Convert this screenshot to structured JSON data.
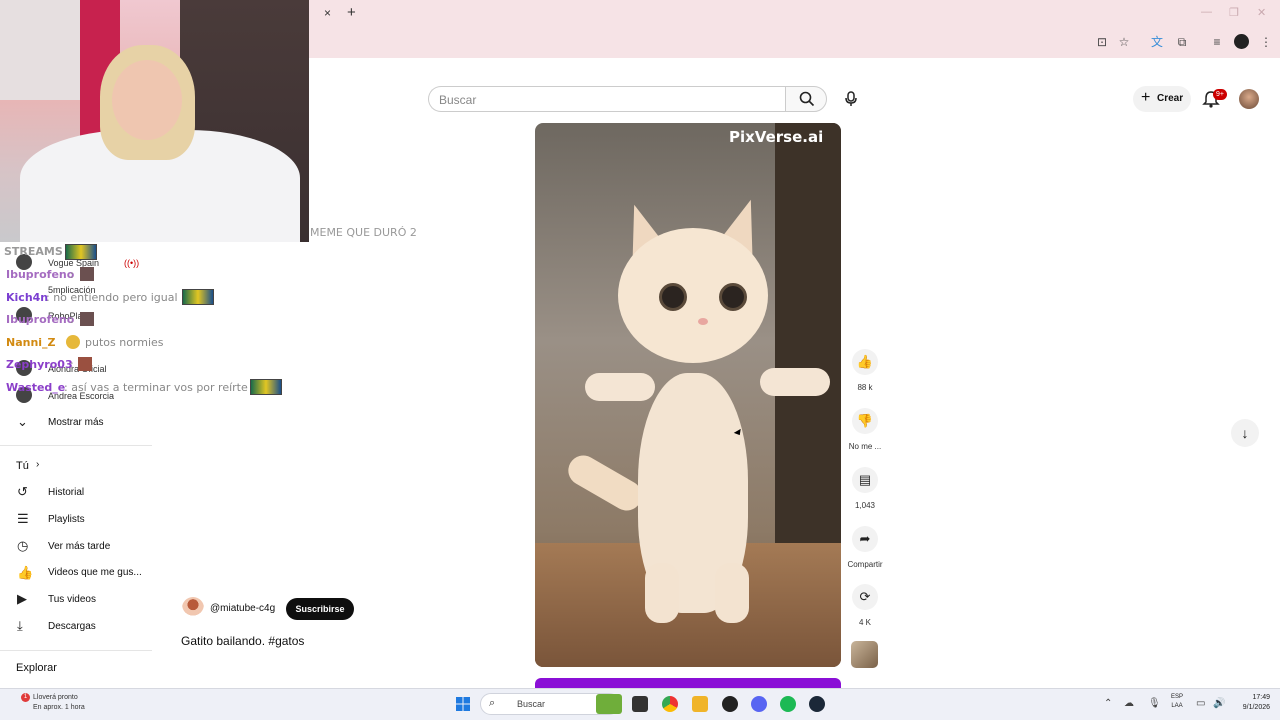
{
  "browser": {
    "tab_close": "×",
    "tab_new": "+",
    "window_controls": [
      "—",
      "❐",
      "✕"
    ]
  },
  "header": {
    "search_placeholder": "Buscar",
    "create_label": "Crear",
    "notifications_badge": "9+"
  },
  "stream_overlay": {
    "meme_text": "MEME QUE DURÓ 2",
    "streams_label": "STREAMS",
    "chat": [
      {
        "user": "Ibuprofeno",
        "message": ":"
      },
      {
        "user": "Kich4n",
        "message": ": no entiendo pero igual"
      },
      {
        "user": "Ibuprofeno",
        "message": ":"
      },
      {
        "user": "Nanni_Z",
        "message": "putos normies"
      },
      {
        "user": "Zephyro03",
        "message": ":"
      },
      {
        "user": "Wasted_e",
        "message": ": así vas a terminar vos por reírte"
      }
    ],
    "user_colors": {
      "Ibuprofeno": "#a56cc1",
      "Kich4n": "#7b3fd1",
      "Nanni_Z": "#d28a11",
      "Zephyro03": "#8b3fc9",
      "Wasted_e": "#8b3fc9"
    }
  },
  "sidebar": {
    "subscriptions": [
      {
        "label": "Vogue Spain"
      },
      {
        "label": "5mplicación"
      },
      {
        "label": "RoboPla"
      },
      {
        "label": "Alondra Oficial"
      },
      {
        "label": "Andrea Escorcia"
      }
    ],
    "show_more": "Mostrar más",
    "you_heading": "Tú",
    "you_items": [
      {
        "label": "Historial",
        "icon": "history-icon"
      },
      {
        "label": "Playlists",
        "icon": "playlist-icon"
      },
      {
        "label": "Ver más tarde",
        "icon": "watch-later-icon"
      },
      {
        "label": "Videos que me gus...",
        "icon": "like-icon"
      },
      {
        "label": "Tus videos",
        "icon": "your-videos-icon"
      },
      {
        "label": "Descargas",
        "icon": "download-icon"
      }
    ],
    "explore_heading": "Explorar"
  },
  "video": {
    "watermark": "PixVerse.ai",
    "channel_handle": "@miatube-c4g",
    "subscribe_label": "Suscribirse",
    "title": "Gatito bailando. #gatos"
  },
  "actions": {
    "likes": "88 k",
    "dislike_label": "No me ...",
    "comments": "1,043",
    "share_label": "Compartir",
    "remix": "4 K"
  },
  "taskbar": {
    "weather_line1": "Lloverá pronto",
    "weather_line2": "En aprox. 1 hora",
    "weather_badge": "1",
    "search_label": "Buscar",
    "lang_line1": "ESP",
    "lang_line2": "LAA",
    "time": "17:49",
    "date": "9/1/2026"
  },
  "colors": {
    "browser_chrome": "#f6e3e6",
    "subscribe_bg": "#0f0f0f",
    "next_video_accent": "#8a0fd6",
    "notification_badge": "#cc0000"
  }
}
